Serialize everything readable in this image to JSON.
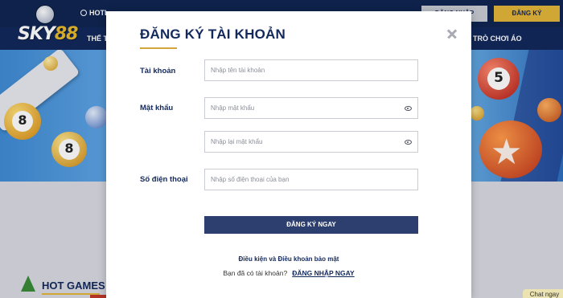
{
  "header": {
    "logo_text": "SKY",
    "logo_num": "88",
    "hotline": "HOTL",
    "login_button": "ĐĂNG NHẬP",
    "register_button": "ĐĂNG KÝ"
  },
  "nav": {
    "left_item": "THẾ T",
    "right_item": "TRÒ CHƠI ÁO"
  },
  "banner": {
    "ball_left": "8",
    "ball_left_2": "8",
    "ball_right": "5"
  },
  "section": {
    "hot_games": "HOT GAMES",
    "chat": "Chat ngay"
  },
  "modal": {
    "title": "ĐĂNG KÝ TÀI KHOẢN",
    "fields": {
      "username_label": "Tài khoản",
      "username_placeholder": "Nhập tên tài khoản",
      "password_label": "Mật khẩu",
      "password_placeholder": "Nhập mật khẩu",
      "confirm_placeholder": "Nhập lại mật khẩu",
      "phone_label": "Số điện thoại",
      "phone_placeholder": "Nhập số điện thoại của bạn"
    },
    "submit": "ĐĂNG KÝ NGAY",
    "terms": "Điều kiện và Điều khoản bảo mật",
    "have_account": "Bạn đã có tài khoản?",
    "login_now": "ĐĂNG NHẬP NGAY"
  },
  "colors": {
    "navy": "#13295c",
    "gold": "#e2b53a",
    "button": "#2d3f6e"
  }
}
